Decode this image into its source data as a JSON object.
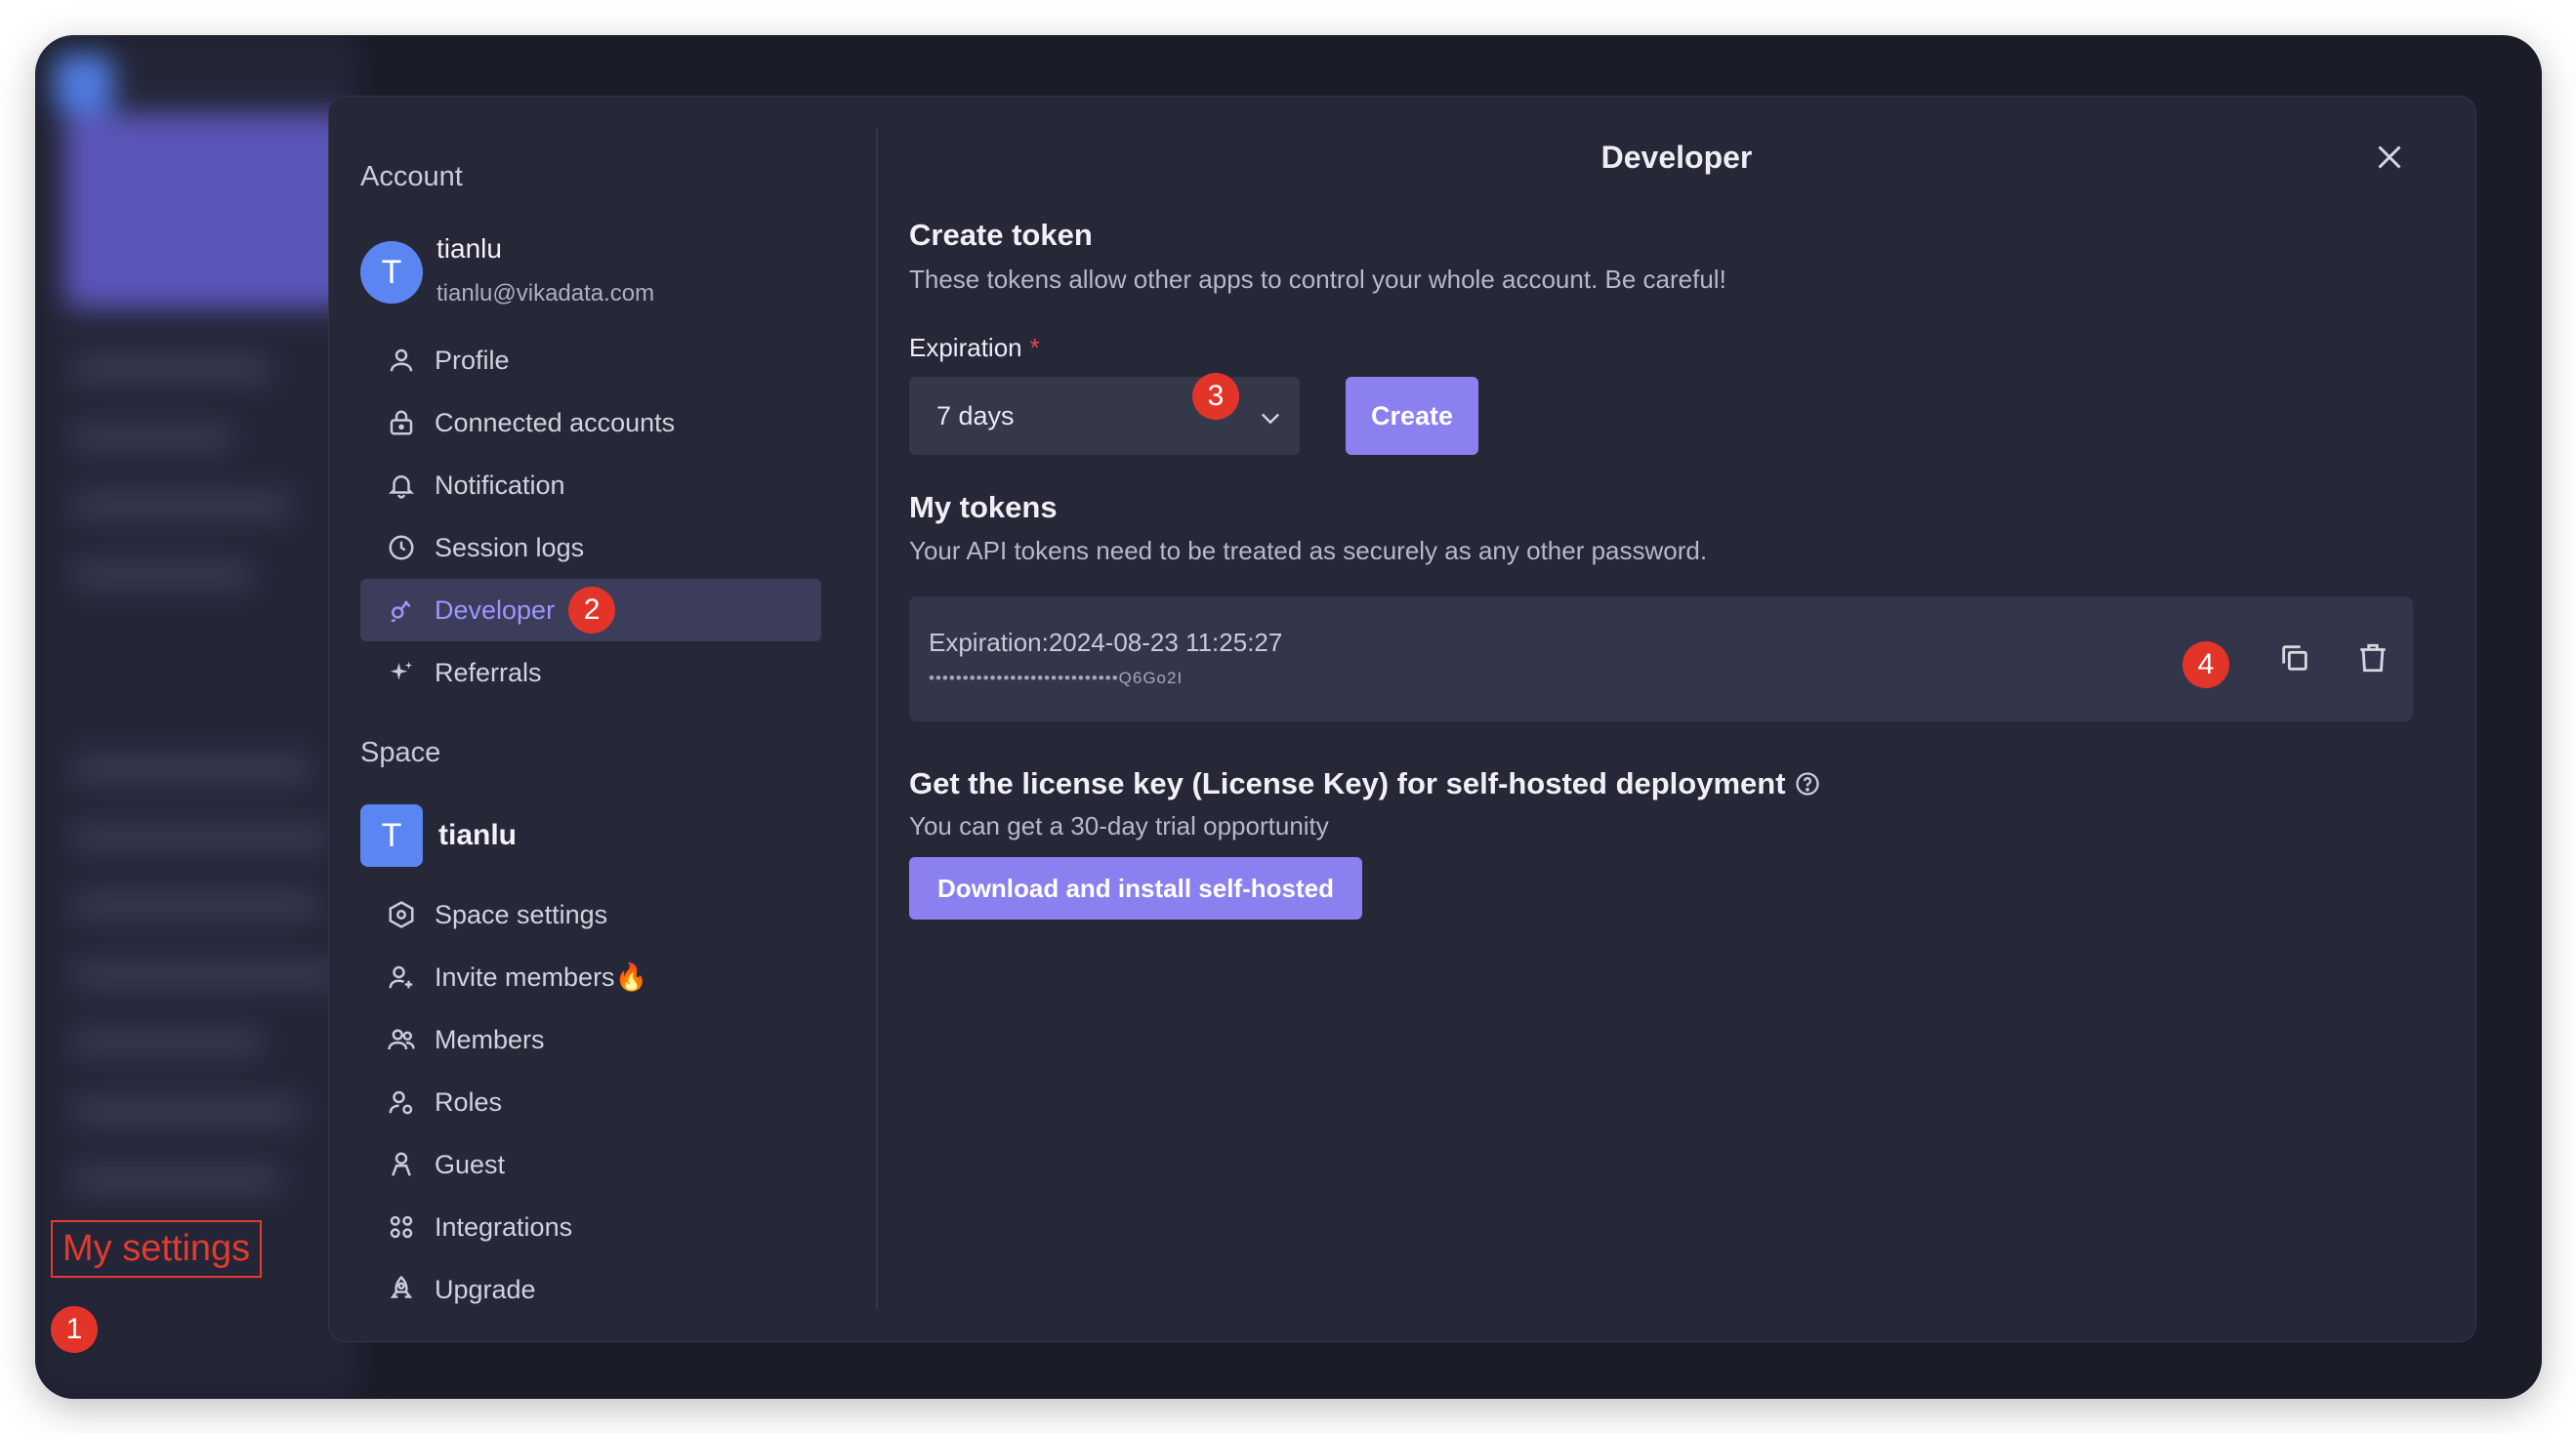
{
  "dialog": {
    "title": "Developer"
  },
  "account": {
    "section_label": "Account",
    "avatar_letter": "T",
    "name": "tianlu",
    "email": "tianlu@vikadata.com",
    "items": [
      {
        "label": "Profile",
        "icon": "user-icon"
      },
      {
        "label": "Connected accounts",
        "icon": "lock-icon"
      },
      {
        "label": "Notification",
        "icon": "bell-icon"
      },
      {
        "label": "Session logs",
        "icon": "clock-icon"
      },
      {
        "label": "Developer",
        "icon": "developer-icon",
        "active": true
      },
      {
        "label": "Referrals",
        "icon": "sparkle-icon"
      }
    ]
  },
  "space": {
    "section_label": "Space",
    "avatar_letter": "T",
    "name": "tianlu",
    "items": [
      {
        "label": "Space settings",
        "icon": "hexagon-settings-icon"
      },
      {
        "label": "Invite members🔥",
        "icon": "invite-user-icon"
      },
      {
        "label": "Members",
        "icon": "members-icon"
      },
      {
        "label": "Roles",
        "icon": "roles-icon"
      },
      {
        "label": "Guest",
        "icon": "guest-icon"
      },
      {
        "label": "Integrations",
        "icon": "integrations-icon"
      },
      {
        "label": "Upgrade",
        "icon": "rocket-icon"
      }
    ]
  },
  "create_token": {
    "title": "Create token",
    "description": "These tokens allow other apps to control your whole account. Be careful!",
    "expiration_label": "Expiration",
    "required_mark": "*",
    "expiration_value": "7 days",
    "create_button": "Create"
  },
  "my_tokens": {
    "title": "My tokens",
    "description": "Your API tokens need to be treated as securely as any other password.",
    "tokens": [
      {
        "expiration": "Expiration:2024-08-23 11:25:27",
        "masked": "••••••••••••••••••••••••••••Q6Go2I"
      }
    ]
  },
  "license": {
    "title": "Get the license key (License Key) for self-hosted deployment",
    "description": "You can get a 30-day trial opportunity",
    "button": "Download and install self-hosted"
  },
  "annotations": {
    "label": "My settings",
    "badges": [
      "1",
      "2",
      "3",
      "4"
    ],
    "color": "#e3342a"
  },
  "colors": {
    "accent": "#8a80f0",
    "active_nav_bg": "#3b3d5a",
    "modal_bg": "#262838"
  }
}
